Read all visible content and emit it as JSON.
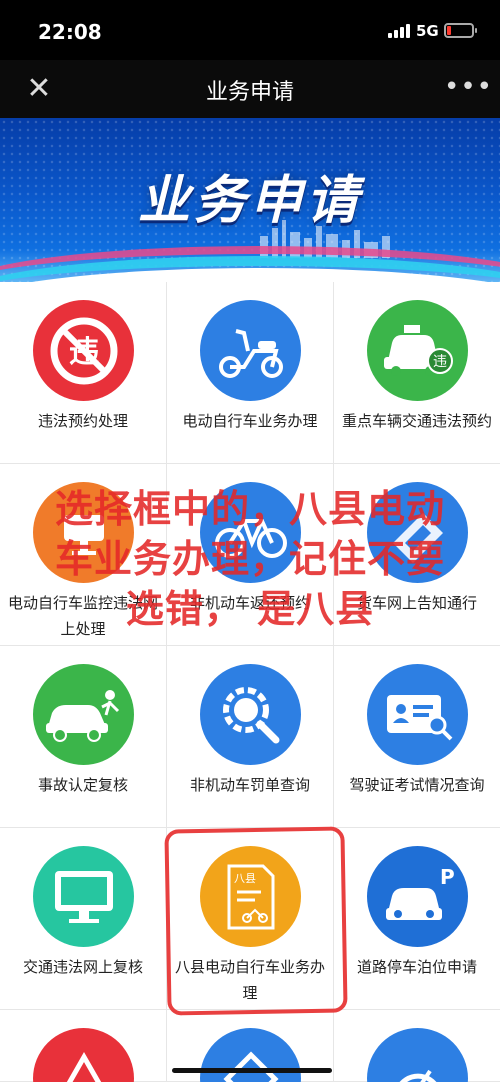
{
  "status_bar": {
    "time": "22:08",
    "network": "5G"
  },
  "nav": {
    "title": "业务申请",
    "close_glyph": "✕",
    "more_glyph": "•••"
  },
  "banner": {
    "title": "业务申请"
  },
  "services": [
    {
      "label": "违法预约处理",
      "icon": "violation-icon",
      "color": "#e8313a"
    },
    {
      "label": "电动自行车业务办理",
      "icon": "e-scooter-icon",
      "color": "#2d7fe3"
    },
    {
      "label": "重点车辆交通违法预约",
      "icon": "taxi-violation-icon",
      "color": "#3bb54a"
    },
    {
      "label": "电动自行车监控违法网上处理",
      "icon": "monitor-icon",
      "color": "#f07b2a"
    },
    {
      "label": "非机动车返还预约",
      "icon": "bicycle-icon",
      "color": "#2d7fe3"
    },
    {
      "label": "货车网上告知通行",
      "icon": "truck-pass-icon",
      "color": "#2d7fe3"
    },
    {
      "label": "事故认定复核",
      "icon": "accident-car-icon",
      "color": "#3bb54a"
    },
    {
      "label": "非机动车罚单查询",
      "icon": "gear-search-icon",
      "color": "#2d7fe3"
    },
    {
      "label": "驾驶证考试情况查询",
      "icon": "id-card-search-icon",
      "color": "#2d7fe3"
    },
    {
      "label": "交通违法网上复核",
      "icon": "monitor-screen-icon",
      "color": "#26c6a0"
    },
    {
      "label": "八县电动自行车业务办理",
      "icon": "document-scooter-icon",
      "color": "#f2a41a",
      "doc_text": "八县"
    },
    {
      "label": "道路停车泊位申请",
      "icon": "parking-car-icon",
      "color": "#1f6fd6",
      "badge": "P"
    }
  ],
  "annotation": {
    "line1": "选择框中的，八县电动",
    "line2": "车业务办理，记住不要",
    "line3": "选错，  是八县"
  }
}
